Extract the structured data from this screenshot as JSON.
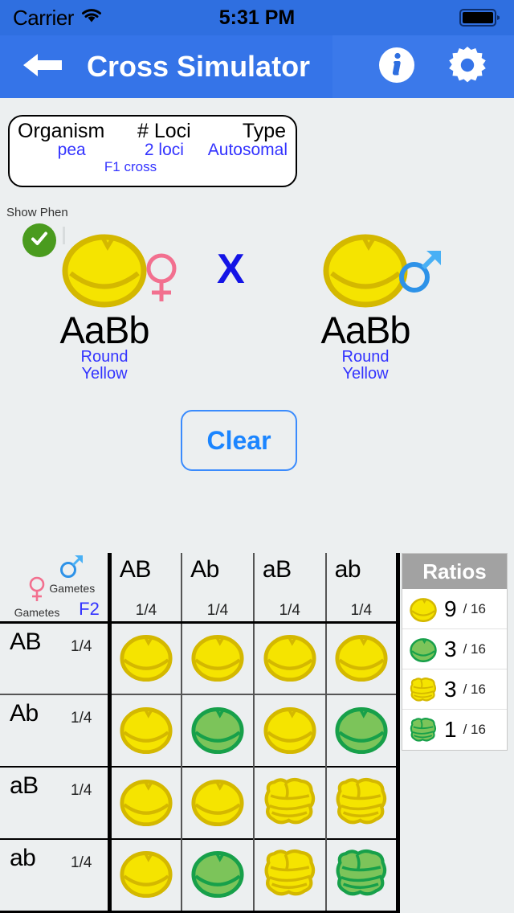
{
  "status_bar": {
    "carrier": "Carrier",
    "wifi_icon": "wifi-icon",
    "time": "5:31 PM",
    "battery_icon": "battery-full-icon"
  },
  "nav_bar": {
    "back_icon": "back-arrow-icon",
    "title": "Cross Simulator",
    "info_icon": "info-icon",
    "settings_icon": "gear-icon",
    "background_color": "#3574e8"
  },
  "info_card": {
    "headers": {
      "organism": "Organism",
      "loci": "# Loci",
      "type": "Type"
    },
    "values": {
      "organism": "pea",
      "loci": "2 loci",
      "type": "Autosomal"
    },
    "cross_label": "F1 cross",
    "value_color": "#3333ff"
  },
  "show_phenotype": {
    "label": "Show Phen",
    "checked": true,
    "check_icon": "check-circle-icon",
    "check_color": "#4a9b1e"
  },
  "parents": {
    "cross_symbol": "X",
    "cross_symbol_color": "#1414e6",
    "female": {
      "sex_icon": "female-symbol-icon",
      "sex_color": "#f2708f",
      "genotype": "AaBb",
      "phenotype_line1": "Round",
      "phenotype_line2": "Yellow",
      "seed_shape": "round",
      "seed_color": "#f5e400"
    },
    "male": {
      "sex_icon": "male-symbol-icon",
      "sex_color": "#2d92e8",
      "genotype": "AaBb",
      "phenotype_line1": "Round",
      "phenotype_line2": "Yellow",
      "seed_shape": "round",
      "seed_color": "#f5e400"
    }
  },
  "clear_button": {
    "label": "Clear",
    "color": "#1b85ff"
  },
  "punnett": {
    "corner": {
      "female_caption": "Gametes",
      "male_caption": "Gametes",
      "generation": "F2",
      "female_icon": "female-symbol-icon",
      "male_icon": "male-symbol-icon"
    },
    "columns": [
      {
        "label": "AB",
        "fraction": "1/4"
      },
      {
        "label": "Ab",
        "fraction": "1/4"
      },
      {
        "label": "aB",
        "fraction": "1/4"
      },
      {
        "label": "ab",
        "fraction": "1/4"
      }
    ],
    "rows": [
      {
        "label": "AB",
        "fraction": "1/4",
        "cells": [
          "round-yellow",
          "round-yellow",
          "round-yellow",
          "round-yellow"
        ]
      },
      {
        "label": "Ab",
        "fraction": "1/4",
        "cells": [
          "round-yellow",
          "round-green",
          "round-yellow",
          "round-green"
        ]
      },
      {
        "label": "aB",
        "fraction": "1/4",
        "cells": [
          "round-yellow",
          "round-yellow",
          "wrinkled-yellow",
          "wrinkled-yellow"
        ]
      },
      {
        "label": "ab",
        "fraction": "1/4",
        "cells": [
          "round-yellow",
          "round-green",
          "wrinkled-yellow",
          "wrinkled-green"
        ]
      }
    ]
  },
  "ratios": {
    "title": "Ratios",
    "items": [
      {
        "phenotype": "round-yellow",
        "count": "9",
        "denominator": "/ 16"
      },
      {
        "phenotype": "round-green",
        "count": "3",
        "denominator": "/ 16"
      },
      {
        "phenotype": "wrinkled-yellow",
        "count": "3",
        "denominator": "/ 16"
      },
      {
        "phenotype": "wrinkled-green",
        "count": "1",
        "denominator": "/ 16"
      }
    ]
  },
  "colors": {
    "seed_yellow": "#f5e400",
    "seed_yellow_edge": "#d4b800",
    "seed_green": "#7cc45a",
    "seed_green_edge": "#17a04a",
    "page_background": "#eceff0"
  }
}
